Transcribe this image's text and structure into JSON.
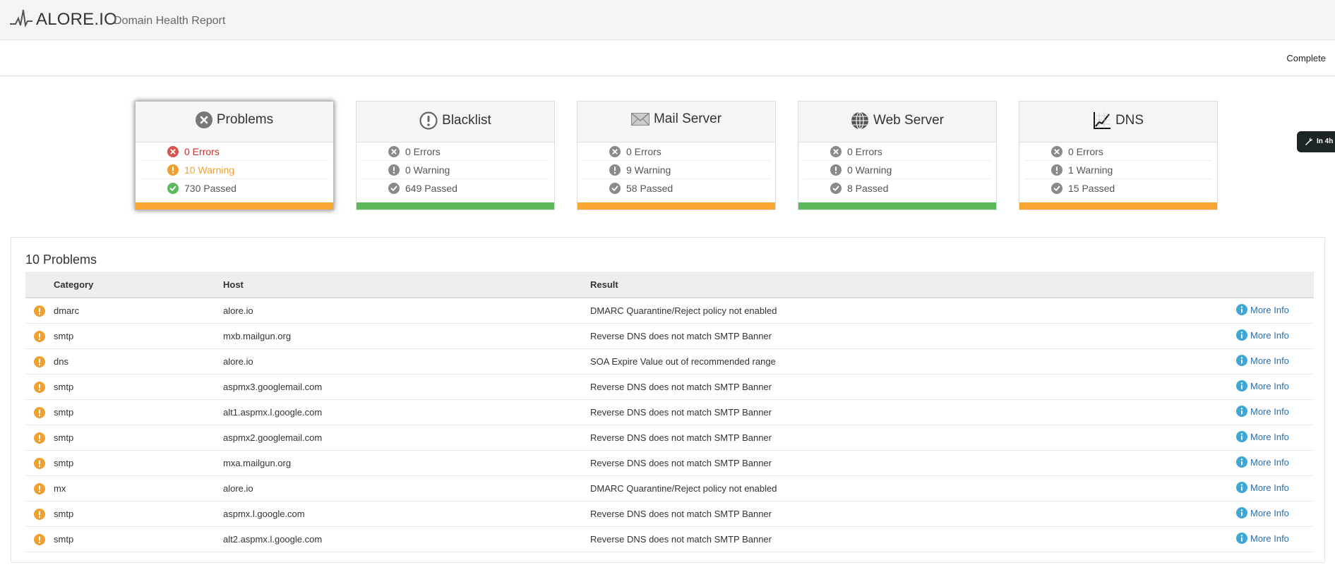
{
  "header": {
    "brand": "ALORE.IO",
    "subtitle": "Domain Health Report",
    "status": "Complete"
  },
  "floating_tab": {
    "label": "In 4h",
    "icon": "wrench-icon"
  },
  "colors": {
    "orange": "#f8a532",
    "green": "#5cb85c",
    "red": "#d9534f",
    "gray": "#8a8a8a",
    "link": "#2a6fb0"
  },
  "cards": [
    {
      "title": "Problems",
      "icon": "x-circle-icon",
      "errors": "0 Errors",
      "warning": "10 Warning",
      "passed": "730 Passed",
      "bar": "orange"
    },
    {
      "title": "Blacklist",
      "icon": "exclamation-circle-icon",
      "errors": "0 Errors",
      "warning": "0 Warning",
      "passed": "649 Passed",
      "bar": "green"
    },
    {
      "title": "Mail Server",
      "icon": "envelope-icon",
      "errors": "0 Errors",
      "warning": "9 Warning",
      "passed": "58 Passed",
      "bar": "orange"
    },
    {
      "title": "Web Server",
      "icon": "globe-icon",
      "errors": "0 Errors",
      "warning": "0 Warning",
      "passed": "8 Passed",
      "bar": "green"
    },
    {
      "title": "DNS",
      "icon": "chart-icon",
      "errors": "0 Errors",
      "warning": "1 Warning",
      "passed": "15 Passed",
      "bar": "orange"
    }
  ],
  "problems": {
    "title": "10 Problems",
    "columns": {
      "category": "Category",
      "host": "Host",
      "result": "Result"
    },
    "more_label": "More Info",
    "rows": [
      {
        "category": "dmarc",
        "host": "alore.io",
        "result": "DMARC Quarantine/Reject policy not enabled"
      },
      {
        "category": "smtp",
        "host": "mxb.mailgun.org",
        "result": "Reverse DNS does not match SMTP Banner"
      },
      {
        "category": "dns",
        "host": "alore.io",
        "result": "SOA Expire Value out of recommended range"
      },
      {
        "category": "smtp",
        "host": "aspmx3.googlemail.com",
        "result": "Reverse DNS does not match SMTP Banner"
      },
      {
        "category": "smtp",
        "host": "alt1.aspmx.l.google.com",
        "result": "Reverse DNS does not match SMTP Banner"
      },
      {
        "category": "smtp",
        "host": "aspmx2.googlemail.com",
        "result": "Reverse DNS does not match SMTP Banner"
      },
      {
        "category": "smtp",
        "host": "mxa.mailgun.org",
        "result": "Reverse DNS does not match SMTP Banner"
      },
      {
        "category": "mx",
        "host": "alore.io",
        "result": "DMARC Quarantine/Reject policy not enabled"
      },
      {
        "category": "smtp",
        "host": "aspmx.l.google.com",
        "result": "Reverse DNS does not match SMTP Banner"
      },
      {
        "category": "smtp",
        "host": "alt2.aspmx.l.google.com",
        "result": "Reverse DNS does not match SMTP Banner"
      }
    ]
  }
}
